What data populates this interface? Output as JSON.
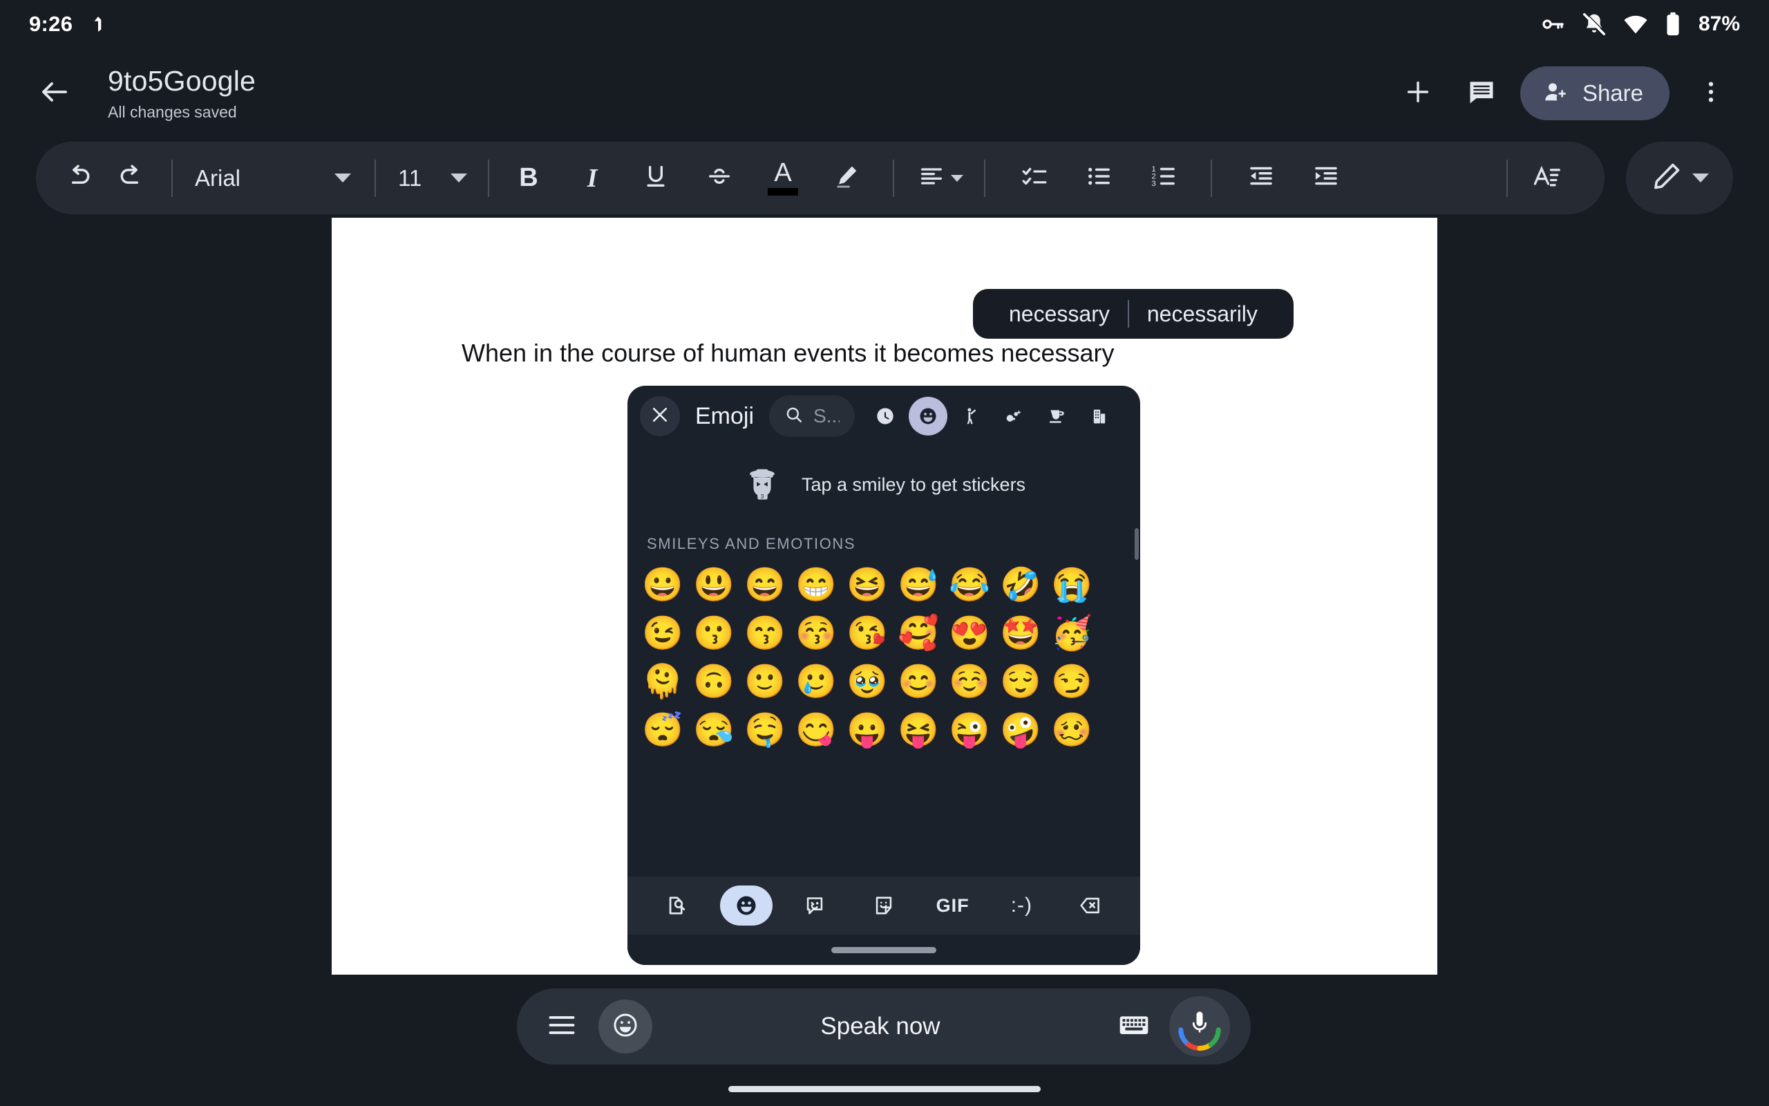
{
  "status_bar": {
    "time": "9:26",
    "left_icons": [
      "navigation-arrow-icon"
    ],
    "right_icons": [
      "vpn-key-icon",
      "notifications-muted-icon",
      "wifi-icon",
      "battery-icon"
    ],
    "battery_percent": "87%"
  },
  "app_bar": {
    "back_icon": "back-arrow-icon",
    "title": "9to5Google",
    "subtitle": "All changes saved",
    "add_icon": "plus-icon",
    "comment_icon": "comment-icon",
    "share_label": "Share",
    "share_icon": "person-add-icon",
    "overflow_icon": "more-vert-icon",
    "share_bg": "#464d63"
  },
  "toolbar": {
    "undo_icon": "undo-icon",
    "redo_icon": "redo-icon",
    "font_name": "Arial",
    "font_size": "11",
    "bold_label": "B",
    "italic_label": "I",
    "underline_label": "U",
    "strikethrough_icon": "strikethrough-icon",
    "text_color_label": "A",
    "text_color_swatch": "#000000",
    "highlight_icon": "highlight-pen-icon",
    "align_icon": "align-left-icon",
    "checklist_icon": "checklist-icon",
    "bulleted_list_icon": "bulleted-list-icon",
    "numbered_list_icon": "numbered-list-icon",
    "decrease_indent_icon": "decrease-indent-icon",
    "increase_indent_icon": "increase-indent-icon",
    "text_format_icon": "text-format-icon",
    "pen_icon": "pencil-icon",
    "pen_caret_icon": "chevron-down-icon",
    "bg": "#262b33"
  },
  "document": {
    "body_text": "When in the course of human events it becomes necessary",
    "page_bg": "#ffffff"
  },
  "suggestions": {
    "items": [
      {
        "word": "necessary"
      },
      {
        "word": "necessarily"
      }
    ],
    "bg": "#181d25"
  },
  "emoji_panel": {
    "close_icon": "close-icon",
    "title": "Emoji",
    "search_icon": "search-icon",
    "search_placeholder": "S...",
    "categories": [
      {
        "name": "recent-icon",
        "glyph": "recent",
        "active": false
      },
      {
        "name": "smileys-icon",
        "glyph": "smiley",
        "active": true
      },
      {
        "name": "people-icon",
        "glyph": "person",
        "active": false
      },
      {
        "name": "animals-nature-icon",
        "glyph": "nature",
        "active": false
      },
      {
        "name": "food-drink-icon",
        "glyph": "food",
        "active": false
      },
      {
        "name": "travel-places-icon",
        "glyph": "travel",
        "active": false
      }
    ],
    "sticker_promo": {
      "icon": "emoji-kitchen-sticker-icon",
      "label": "Tap a smiley to get stickers"
    },
    "section_title": "SMILEYS AND EMOTIONS",
    "emoji_rows": [
      [
        "😀",
        "😃",
        "😄",
        "😁",
        "😆",
        "😅",
        "😂",
        "🤣",
        "😭"
      ],
      [
        "😉",
        "😗",
        "😙",
        "😚",
        "😘",
        "🥰",
        "😍",
        "🤩",
        "🥳"
      ],
      [
        "🫠",
        "🙃",
        "🙂",
        "🥲",
        "🥹",
        "😊",
        "☺️",
        "😌",
        "😏"
      ],
      [
        "😴",
        "😪",
        "🤤",
        "😋",
        "😛",
        "😝",
        "😜",
        "🤪",
        "🥴"
      ]
    ],
    "bottom_bar": [
      {
        "name": "search-document-icon",
        "label": "",
        "active": false
      },
      {
        "name": "emoji-icon",
        "label": "",
        "active": true
      },
      {
        "name": "emoji-kitchen-icon",
        "label": "",
        "active": false
      },
      {
        "name": "sticker-icon",
        "label": "",
        "active": false
      },
      {
        "name": "gif-button",
        "label": "GIF",
        "active": false
      },
      {
        "name": "emoticon-button",
        "label": ":-)",
        "active": false
      },
      {
        "name": "backspace-icon",
        "label": "",
        "active": false
      }
    ],
    "bg": "#1b212b",
    "active_highlight": "#b9bedd"
  },
  "voice_bar": {
    "menu_icon": "hamburger-menu-icon",
    "emoji_icon": "emoji-face-icon",
    "prompt": "Speak now",
    "keyboard_icon": "keyboard-icon",
    "mic_icon": "microphone-icon",
    "bg": "#2b313b"
  }
}
